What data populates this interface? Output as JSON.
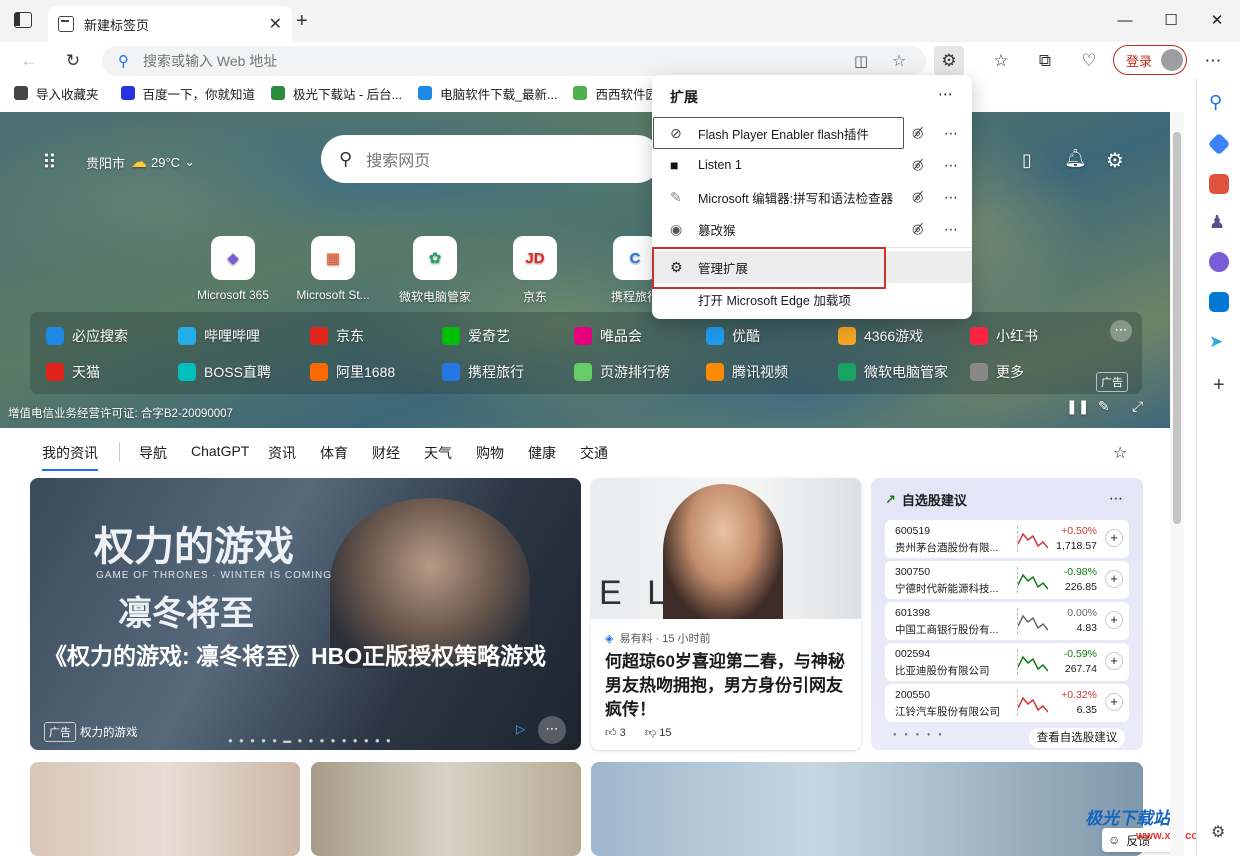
{
  "tab": {
    "title": "新建标签页"
  },
  "address": {
    "placeholder": "搜索或输入 Web 地址"
  },
  "login": {
    "label": "登录"
  },
  "favorites": [
    {
      "label": "导入收藏夹",
      "color": "#444"
    },
    {
      "label": "百度一下，你就知道",
      "color": "#2932e1"
    },
    {
      "label": "极光下载站 - 后台...",
      "color": "#2a8c3a"
    },
    {
      "label": "电脑软件下载_最新...",
      "color": "#1e88e5"
    },
    {
      "label": "西西软件园",
      "color": "#4caf50"
    }
  ],
  "hero": {
    "city": "贵阳市",
    "temp": "29°C",
    "search_placeholder": "搜索网页",
    "license": "增值电信业务经营许可证: 合字B2-20090007",
    "ad": "广告",
    "quicklinks": [
      {
        "label": "Microsoft 365",
        "glyph": "◆",
        "color": "#7b5cd6"
      },
      {
        "label": "Microsoft St...",
        "glyph": "▦",
        "color": "#f25022"
      },
      {
        "label": "微软电脑管家",
        "glyph": "✿",
        "color": "#1aa260"
      },
      {
        "label": "京东",
        "glyph": "JD",
        "color": "#e1251b"
      },
      {
        "label": "携程旅行",
        "glyph": "C",
        "color": "#2577e3"
      }
    ],
    "links_row1": [
      {
        "label": "必应搜索",
        "color": "#1e88e5"
      },
      {
        "label": "哔哩哔哩",
        "color": "#23ade5"
      },
      {
        "label": "京东",
        "color": "#e1251b"
      },
      {
        "label": "爱奇艺",
        "color": "#00be06"
      },
      {
        "label": "唯品会",
        "color": "#e4007f"
      },
      {
        "label": "优酷",
        "color": "#1f9cf0"
      },
      {
        "label": "4366游戏",
        "color": "#f5a623"
      },
      {
        "label": "小红书",
        "color": "#ff2442"
      }
    ],
    "links_row2": [
      {
        "label": "天猫",
        "color": "#e2231a"
      },
      {
        "label": "BOSS直聘",
        "color": "#00bebd"
      },
      {
        "label": "阿里1688",
        "color": "#ff6a00"
      },
      {
        "label": "携程旅行",
        "color": "#2577e3"
      },
      {
        "label": "页游排行榜",
        "color": "#6c6"
      },
      {
        "label": "腾讯视频",
        "color": "#ff8a00"
      },
      {
        "label": "微软电脑管家",
        "color": "#1aa260"
      },
      {
        "label": "更多",
        "color": "#888"
      }
    ]
  },
  "news_nav": [
    "我的资讯",
    "导航",
    "ChatGPT",
    "资讯",
    "体育",
    "财经",
    "天气",
    "购物",
    "健康",
    "交通"
  ],
  "card_main": {
    "poster_title": "权力的游戏",
    "poster_sub1": "GAME OF THRONES · WINTER IS COMING",
    "poster_sub2": "凛冬将至",
    "headline": "《权力的游戏: 凛冬将至》HBO正版授权策略游戏",
    "ad": "广告",
    "source": "权力的游戏"
  },
  "card_mid": {
    "source": "易有料 · 15 小时前",
    "headline": "何超琼60岁喜迎第二春，与神秘男友热吻拥抱，男方身份引网友疯传！",
    "likes": "3",
    "dislikes": "15",
    "backdrop": "E L T"
  },
  "stocks": {
    "title": "自选股建议",
    "footer": "查看自选股建议",
    "items": [
      {
        "code": "600519",
        "name": "贵州茅台酒股份有限...",
        "change": "+0.50%",
        "price": "1,718.57",
        "color": "#d13438"
      },
      {
        "code": "300750",
        "name": "宁德时代新能源科技...",
        "change": "-0.98%",
        "price": "226.85",
        "color": "#107c10"
      },
      {
        "code": "601398",
        "name": "中国工商银行股份有...",
        "change": "0.00%",
        "price": "4.83",
        "color": "#666666"
      },
      {
        "code": "002594",
        "name": "比亚迪股份有限公司",
        "change": "-0.59%",
        "price": "267.74",
        "color": "#107c10"
      },
      {
        "code": "200550",
        "name": "江铃汽车股份有限公司",
        "change": "+0.32%",
        "price": "6.35",
        "color": "#d13438"
      }
    ]
  },
  "extensions": {
    "title": "扩展",
    "items": [
      {
        "label": "Flash Player Enabler flash插件"
      },
      {
        "label": "Listen 1"
      },
      {
        "label": "Microsoft 编辑器:拼写和语法检查器"
      },
      {
        "label": "篡改猴"
      }
    ],
    "manage": "管理扩展",
    "open_addons": "打开 Microsoft Edge 加载项"
  },
  "feedback": {
    "label": "反馈"
  },
  "watermark": {
    "site": "极光下载站",
    "url": "www.xz7.com"
  }
}
